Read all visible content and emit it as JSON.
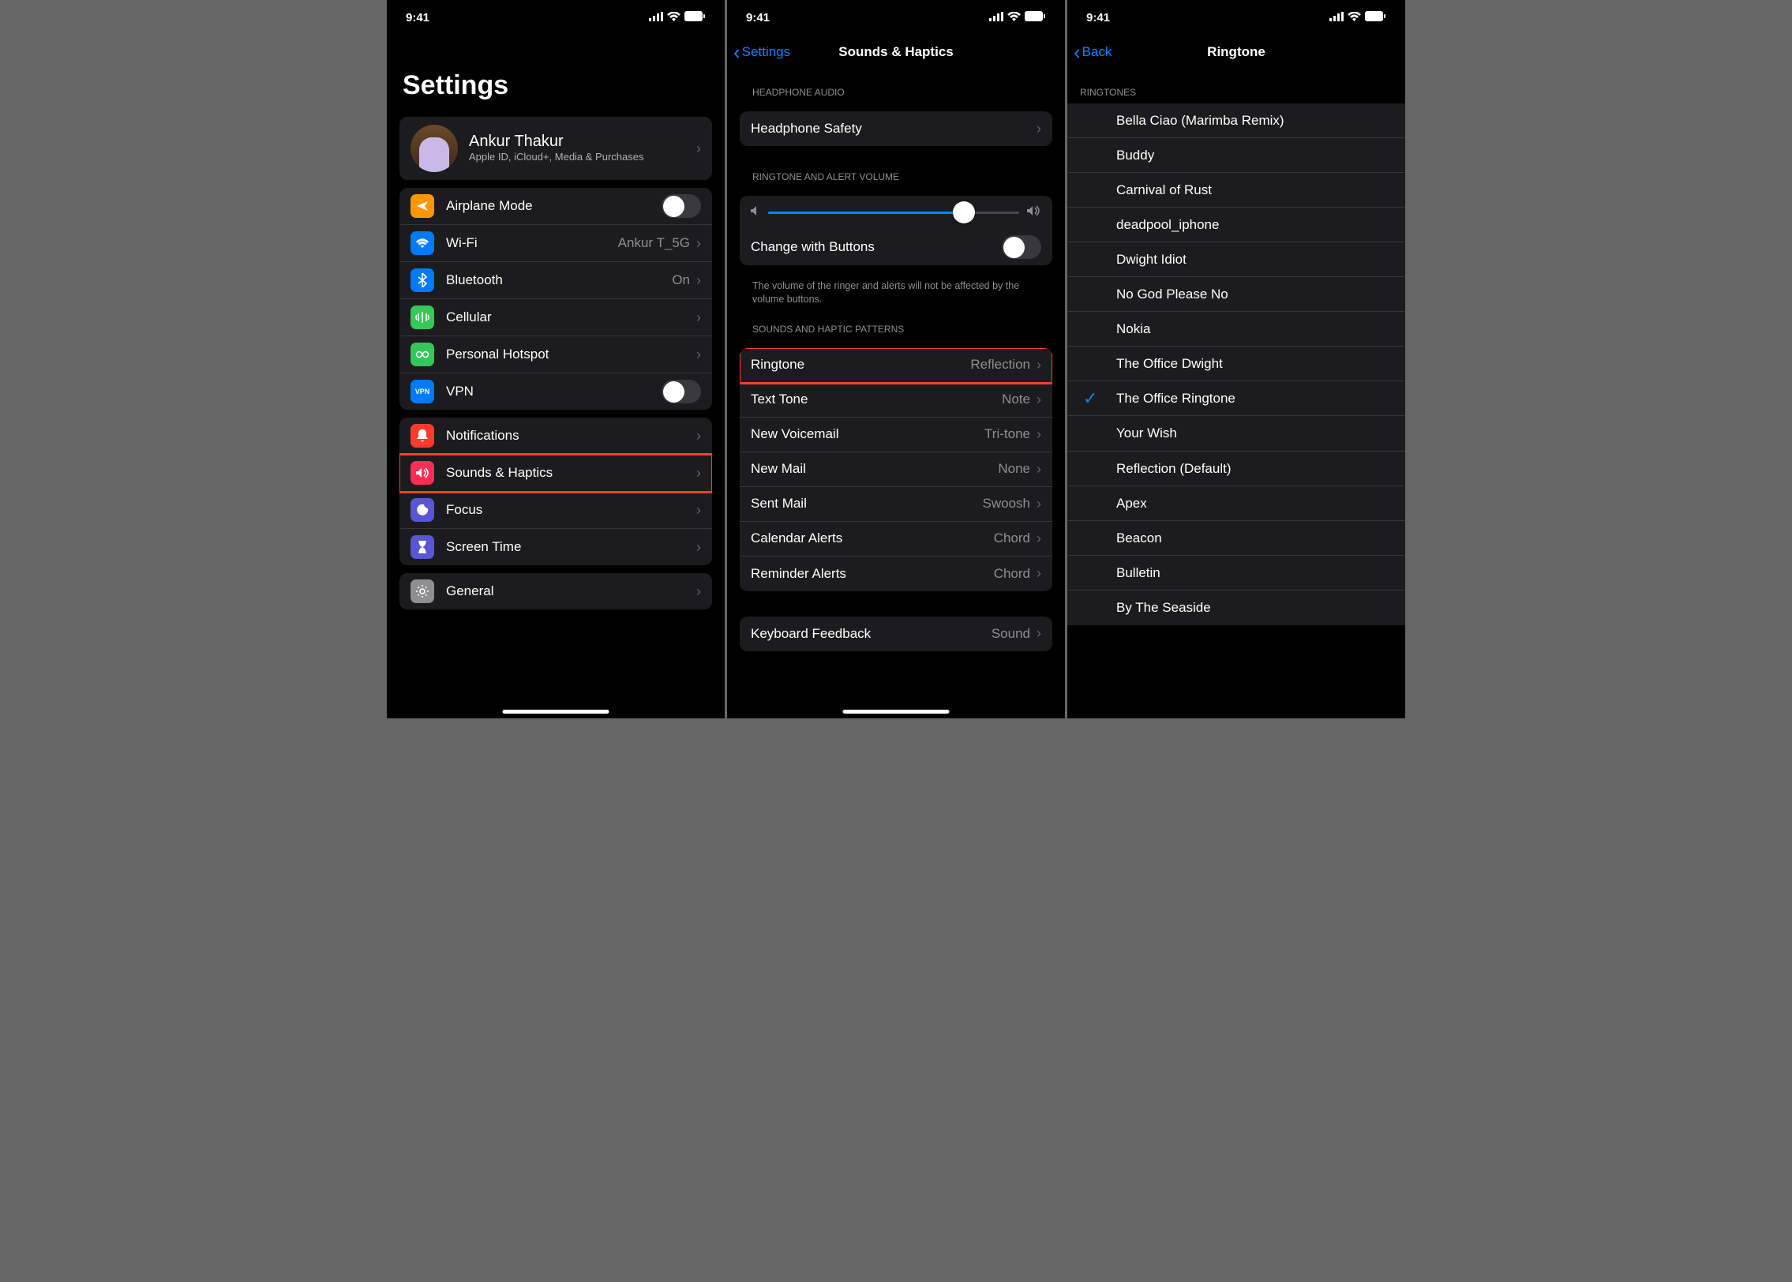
{
  "status": {
    "time": "9:41"
  },
  "phone1": {
    "title": "Settings",
    "profile": {
      "name": "Ankur Thakur",
      "subtitle": "Apple ID, iCloud+, Media & Purchases"
    },
    "group1": [
      {
        "label": "Airplane Mode",
        "type": "toggle",
        "on": false,
        "icon": "airplane",
        "bg": "bg-orange"
      },
      {
        "label": "Wi-Fi",
        "value": "Ankur T_5G",
        "icon": "wifi",
        "bg": "bg-blue"
      },
      {
        "label": "Bluetooth",
        "value": "On",
        "icon": "bluetooth",
        "bg": "bg-bt"
      },
      {
        "label": "Cellular",
        "icon": "cellular",
        "bg": "bg-green"
      },
      {
        "label": "Personal Hotspot",
        "icon": "hotspot",
        "bg": "bg-green2"
      },
      {
        "label": "VPN",
        "type": "toggle",
        "on": false,
        "icon": "vpn",
        "bg": "bg-vpn",
        "vpnText": "VPN"
      }
    ],
    "group2": [
      {
        "label": "Notifications",
        "icon": "notifications",
        "bg": "bg-red"
      },
      {
        "label": "Sounds & Haptics",
        "icon": "sounds",
        "bg": "bg-pink",
        "highlight": true
      },
      {
        "label": "Focus",
        "icon": "focus",
        "bg": "bg-purple"
      },
      {
        "label": "Screen Time",
        "icon": "screentime",
        "bg": "bg-purple2"
      }
    ],
    "group3": [
      {
        "label": "General",
        "icon": "general",
        "bg": "bg-gray"
      }
    ]
  },
  "phone2": {
    "back": "Settings",
    "title": "Sounds & Haptics",
    "sections": {
      "headphone_header": "HEADPHONE AUDIO",
      "headphone_items": [
        {
          "label": "Headphone Safety"
        }
      ],
      "volume_header": "RINGTONE AND ALERT VOLUME",
      "slider_percent": 78,
      "change_with_buttons": {
        "label": "Change with Buttons",
        "on": false
      },
      "volume_footer": "The volume of the ringer and alerts will not be affected by the volume buttons.",
      "patterns_header": "SOUNDS AND HAPTIC PATTERNS",
      "patterns": [
        {
          "label": "Ringtone",
          "value": "Reflection",
          "highlight": true
        },
        {
          "label": "Text Tone",
          "value": "Note"
        },
        {
          "label": "New Voicemail",
          "value": "Tri-tone"
        },
        {
          "label": "New Mail",
          "value": "None"
        },
        {
          "label": "Sent Mail",
          "value": "Swoosh"
        },
        {
          "label": "Calendar Alerts",
          "value": "Chord"
        },
        {
          "label": "Reminder Alerts",
          "value": "Chord"
        }
      ],
      "keyboard_items": [
        {
          "label": "Keyboard Feedback",
          "value": "Sound"
        }
      ]
    }
  },
  "phone3": {
    "back": "Back",
    "title": "Ringtone",
    "header": "RINGTONES",
    "custom": [
      "Bella Ciao (Marimba Remix)",
      "Buddy",
      "Carnival of Rust",
      "deadpool_iphone",
      "Dwight Idiot",
      "No God Please No",
      "Nokia",
      "The Office Dwight",
      "The Office Ringtone",
      "Your Wish"
    ],
    "selected": "The Office Ringtone",
    "builtin": [
      "Reflection (Default)",
      "Apex",
      "Beacon",
      "Bulletin",
      "By The Seaside"
    ]
  }
}
